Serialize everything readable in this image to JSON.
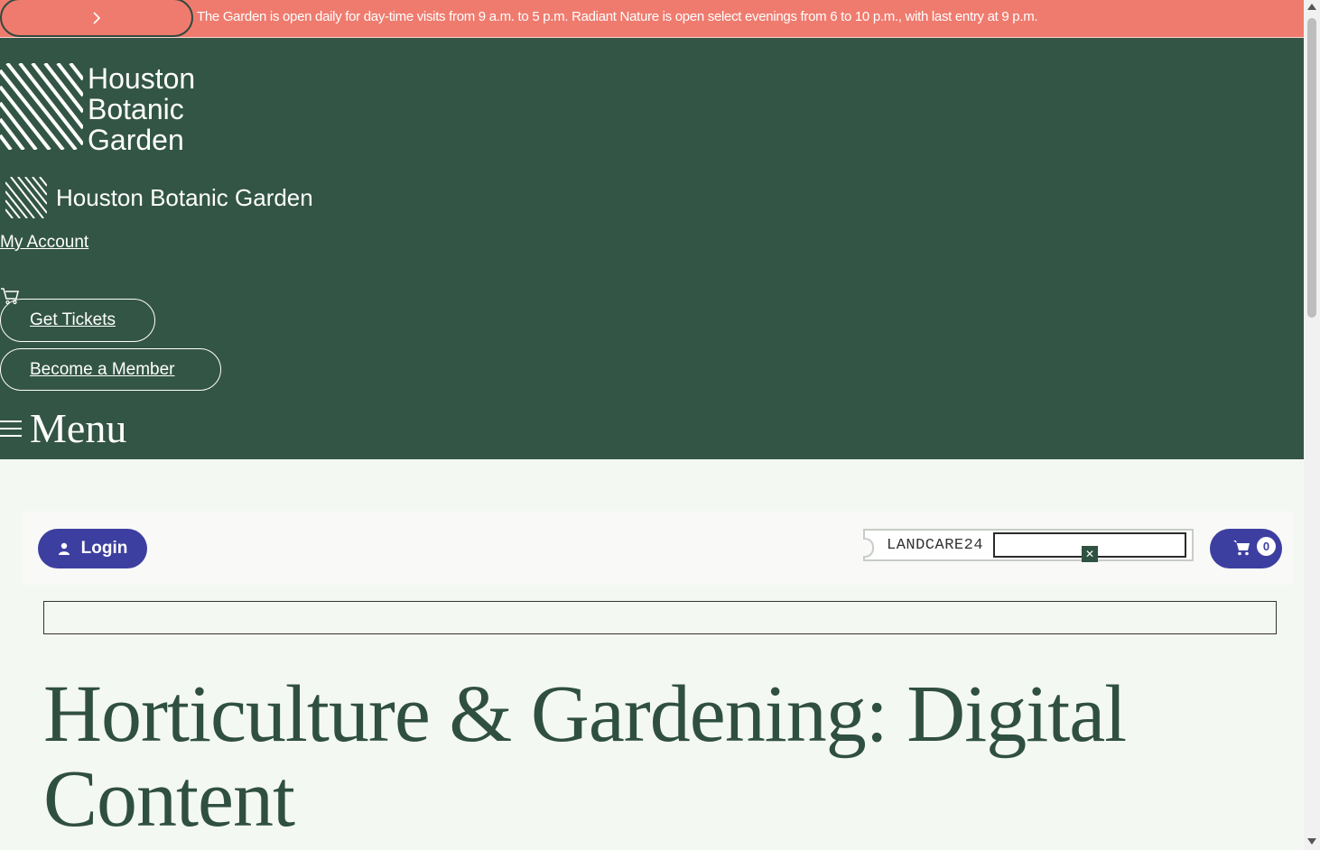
{
  "announcement": {
    "text": "The Garden is open daily for day-time visits from 9 a.m. to 5 p.m. Radiant Nature is open select evenings from 6 to 10 p.m., with last entry at 9 p.m.",
    "next_icon": "chevron-right-icon"
  },
  "header": {
    "logo_lines": [
      "Houston",
      "Botanic",
      "Garden"
    ],
    "site_name": "Houston Botanic Garden",
    "account_link": "My Account",
    "cart_icon": "cart-icon",
    "tickets_label": "Get Tickets",
    "member_label": "Become a Member",
    "menu_label": "Menu"
  },
  "toolbar": {
    "login_label": "Login",
    "login_icon": "person-icon",
    "promo_code": "LANDCARE24",
    "promo_input_value": "",
    "promo_clear_icon": "close-icon",
    "cart_count": "0"
  },
  "search": {
    "value": ""
  },
  "page": {
    "title": "Horticulture & Gardening: Digital Content"
  },
  "colors": {
    "announcement_bg": "#ef7b6e",
    "header_bg": "#335545",
    "accent_button": "#3d3fa0",
    "title_text": "#2f4f42",
    "page_bg": "#f4f8f2"
  }
}
